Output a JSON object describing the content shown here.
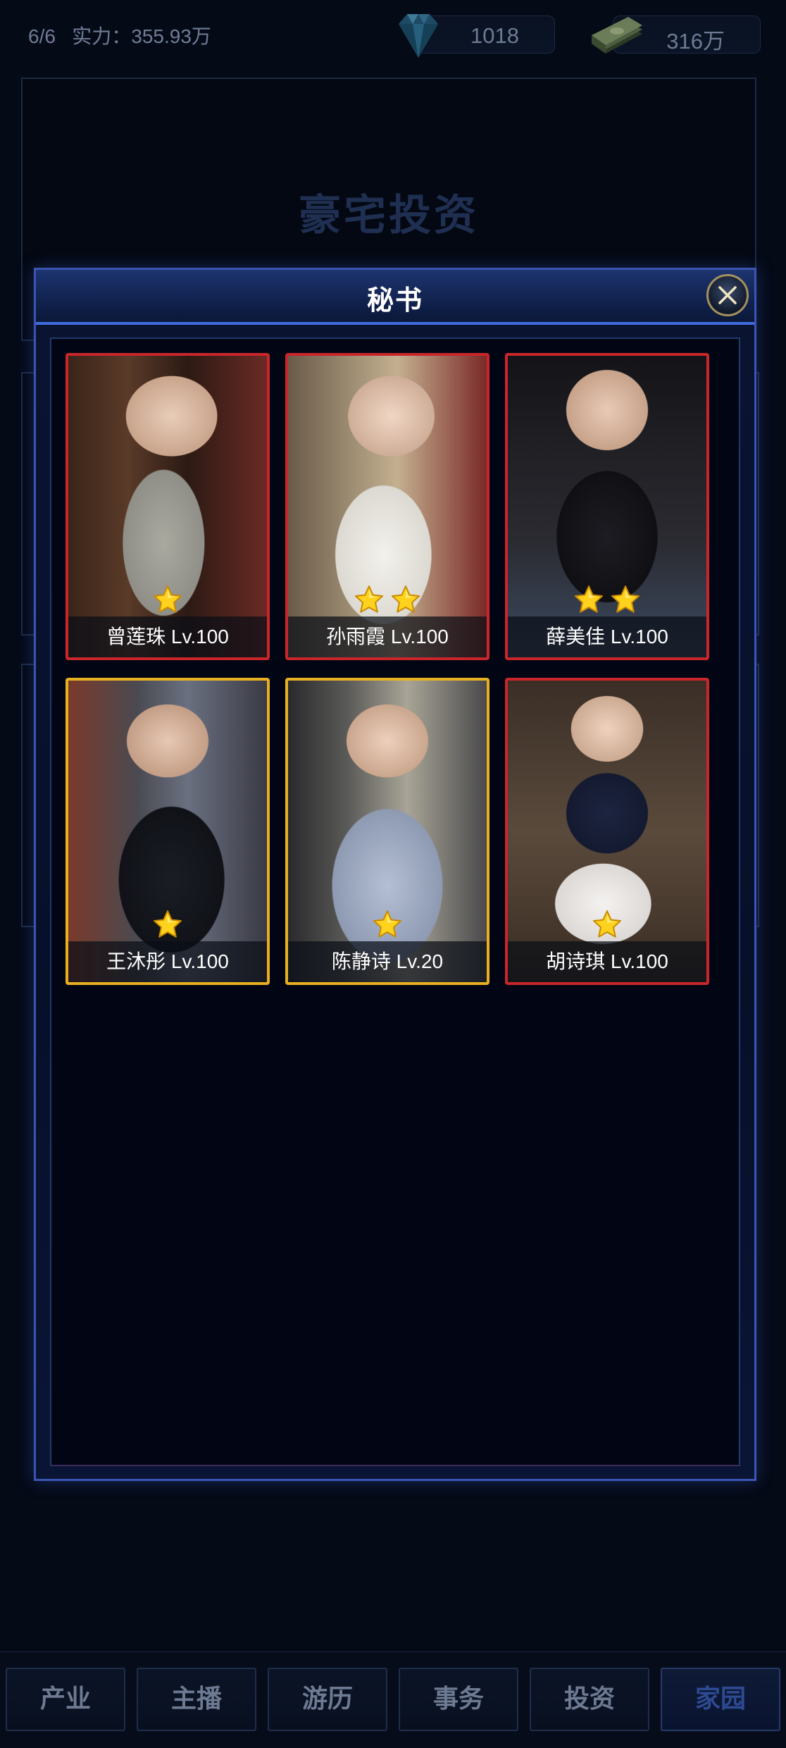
{
  "status": {
    "progress": "6/6",
    "power_label": "实力：355.93万"
  },
  "resources": {
    "diamonds": "1018",
    "cash": "316万"
  },
  "background": {
    "title": "豪宅投资"
  },
  "modal": {
    "title": "秘书",
    "cards": [
      {
        "name": "曾莲珠 Lv.100",
        "stars": 1,
        "frame": "red"
      },
      {
        "name": "孙雨霞 Lv.100",
        "stars": 2,
        "frame": "red"
      },
      {
        "name": "薛美佳 Lv.100",
        "stars": 2,
        "frame": "red"
      },
      {
        "name": "王沐彤 Lv.100",
        "stars": 1,
        "frame": "gold"
      },
      {
        "name": "陈静诗 Lv.20",
        "stars": 1,
        "frame": "gold"
      },
      {
        "name": "胡诗琪 Lv.100",
        "stars": 1,
        "frame": "red"
      }
    ]
  },
  "nav": [
    "产业",
    "主播",
    "游历",
    "事务",
    "投资",
    "家园"
  ],
  "nav_active": "家园",
  "colors": {
    "frame_red": "#c8262a",
    "frame_gold": "#e8b020",
    "accent_blue": "#3f6de0"
  }
}
